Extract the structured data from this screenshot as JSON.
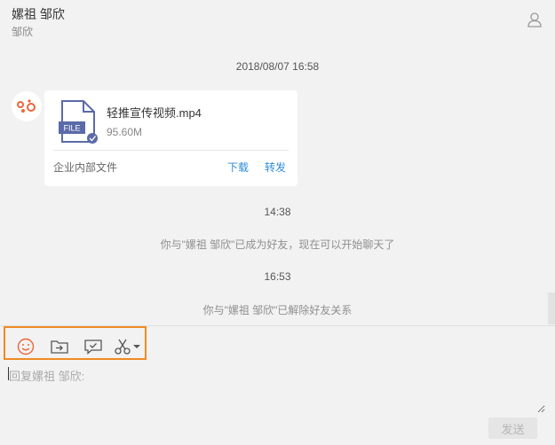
{
  "header": {
    "title": "嫘祖 邹欣",
    "subtitle": "邹欣"
  },
  "messages": {
    "time1": "2018/08/07 16:58",
    "file": {
      "icon_label": "FILE",
      "name": "轻推宣传视频.mp4",
      "size": "95.60M",
      "source": "企业内部文件",
      "download_label": "下载",
      "forward_label": "转发"
    },
    "time2": "14:38",
    "system1": "你与\"嫘祖 邹欣\"已成为好友，现在可以开始聊天了",
    "time3": "16:53",
    "system2": "你与\"嫘祖 邹欣\"已解除好友关系"
  },
  "input": {
    "placeholder": "回复嫘祖 邹欣:",
    "send_label": "发送"
  },
  "colors": {
    "toolbar_highlight": "#f08a24",
    "emoji_icon": "#e8663a",
    "link": "#2e8bd6",
    "file_icon": "#5b6aa8"
  },
  "toolbar": {
    "icons": [
      "emoji-icon",
      "send-file-icon",
      "message-check-icon",
      "scissors-icon"
    ]
  }
}
